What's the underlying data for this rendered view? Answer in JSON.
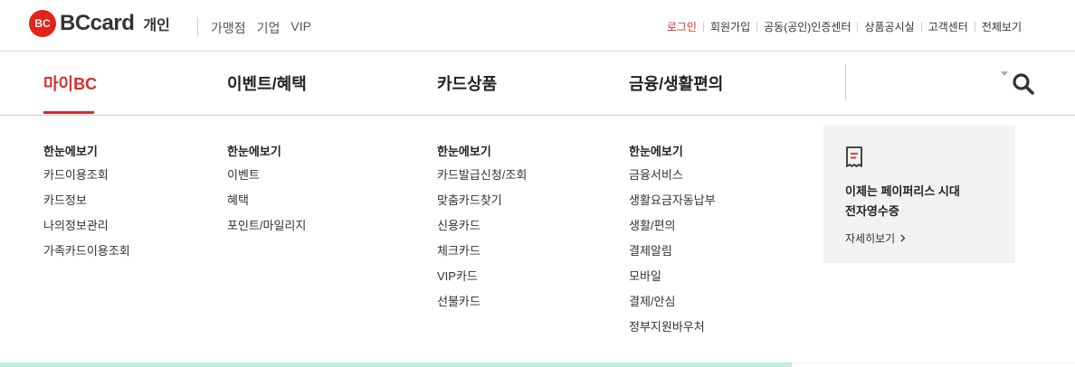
{
  "brand": {
    "mark": "BC",
    "name": "BCcard",
    "segment_current": "개인"
  },
  "segments": [
    "가맹점",
    "기업",
    "VIP"
  ],
  "util_links": [
    {
      "label": "로그인",
      "active": true
    },
    {
      "label": "회원가입",
      "active": false
    },
    {
      "label": "공동(공인)인증센터",
      "active": false
    },
    {
      "label": "상품공시실",
      "active": false
    },
    {
      "label": "고객센터",
      "active": false
    },
    {
      "label": "전체보기",
      "active": false
    }
  ],
  "gnb_tabs": [
    {
      "label": "마이BC",
      "active": true
    },
    {
      "label": "이벤트/혜택",
      "active": false
    },
    {
      "label": "카드상품",
      "active": false
    },
    {
      "label": "금융/생활편의",
      "active": false
    }
  ],
  "columns": [
    {
      "head": "한눈에보기",
      "items": [
        "카드이용조회",
        "카드정보",
        "나의정보관리",
        "가족카드이용조회"
      ]
    },
    {
      "head": "한눈에보기",
      "items": [
        "이벤트",
        "혜택",
        "포인트/마일리지"
      ]
    },
    {
      "head": "한눈에보기",
      "items": [
        "카드발급신청/조회",
        "맞춤카드찾기",
        "신용카드",
        "체크카드",
        "VIP카드",
        "선불카드"
      ]
    },
    {
      "head": "한눈에보기",
      "items": [
        "금융서비스",
        "생활요금자동납부",
        "생활/편의",
        "결제알림",
        "모바일",
        "결제/안심",
        "정부지원바우처"
      ]
    }
  ],
  "promo": {
    "icon": "receipt-icon",
    "title_line1": "이제는 페이퍼리스 시대",
    "title_line2": "전자영수증",
    "link": "자세히보기"
  },
  "colors": {
    "accent": "#d92c2c",
    "logo": "#e2231a",
    "promo_bg": "#f2f2f2",
    "strip": "#c3ede3"
  }
}
